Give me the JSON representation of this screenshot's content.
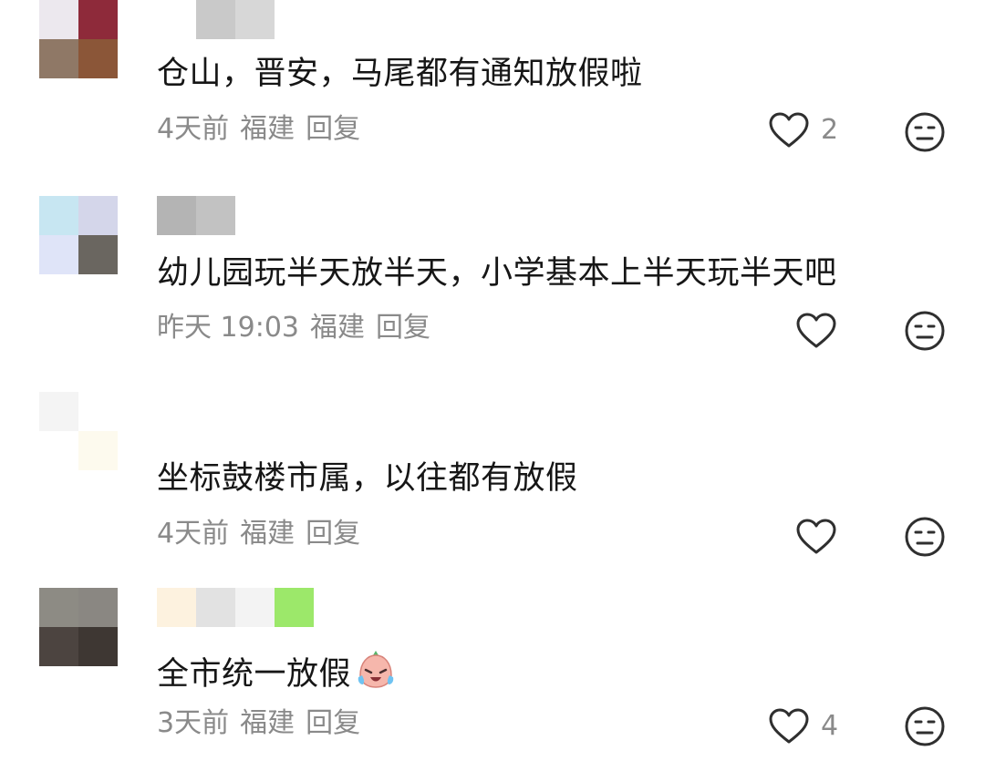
{
  "comments": [
    {
      "text": "仓山，晋安，马尾都有通知放假啦",
      "time": "4天前",
      "location": "福建",
      "reply_label": "回复",
      "like_count": "2",
      "avatar_colors": [
        "#ece8ee",
        "#8e2a3a",
        "#8f7866",
        "#8b5638"
      ],
      "name_colors": [
        "#c9c9c9",
        "#d7d7d7"
      ]
    },
    {
      "text": "幼儿园玩半天放半天，小学基本上半天玩半天吧",
      "time": "昨天 19:03",
      "location": "福建",
      "reply_label": "回复",
      "like_count": "",
      "avatar_colors": [
        "#c7e6f2",
        "#d4d6ea",
        "#dfe4f8",
        "#6a6660"
      ],
      "name_colors": [
        "#b4b4b4",
        "#c2c2c2"
      ]
    },
    {
      "text": "坐标鼓楼市属，以往都有放假",
      "time": "4天前",
      "location": "福建",
      "reply_label": "回复",
      "like_count": "",
      "avatar_colors": [
        "#f4f4f4",
        "#ffffff",
        "#ffffff",
        "#fdfaee"
      ],
      "name_colors": [
        "#ffffff",
        "#ffffff"
      ]
    },
    {
      "text": "全市统一放假",
      "time": "3天前",
      "location": "福建",
      "reply_label": "回复",
      "like_count": "4",
      "avatar_colors": [
        "#8d8b84",
        "#8a8782",
        "#4c4440",
        "#3e3733"
      ],
      "name_colors": [
        "#fdf2df",
        "#e2e2e2",
        "#f3f3f3",
        "#9ce86a"
      ]
    }
  ],
  "icons": {
    "like": "heart-outline-icon",
    "dislike": "neutral-face-icon",
    "emoji": "crying-laughing-emoji-icon"
  },
  "colors": {
    "text": "#161616",
    "meta": "#8a8a8a",
    "icon_stroke": "#2f2f2f"
  }
}
